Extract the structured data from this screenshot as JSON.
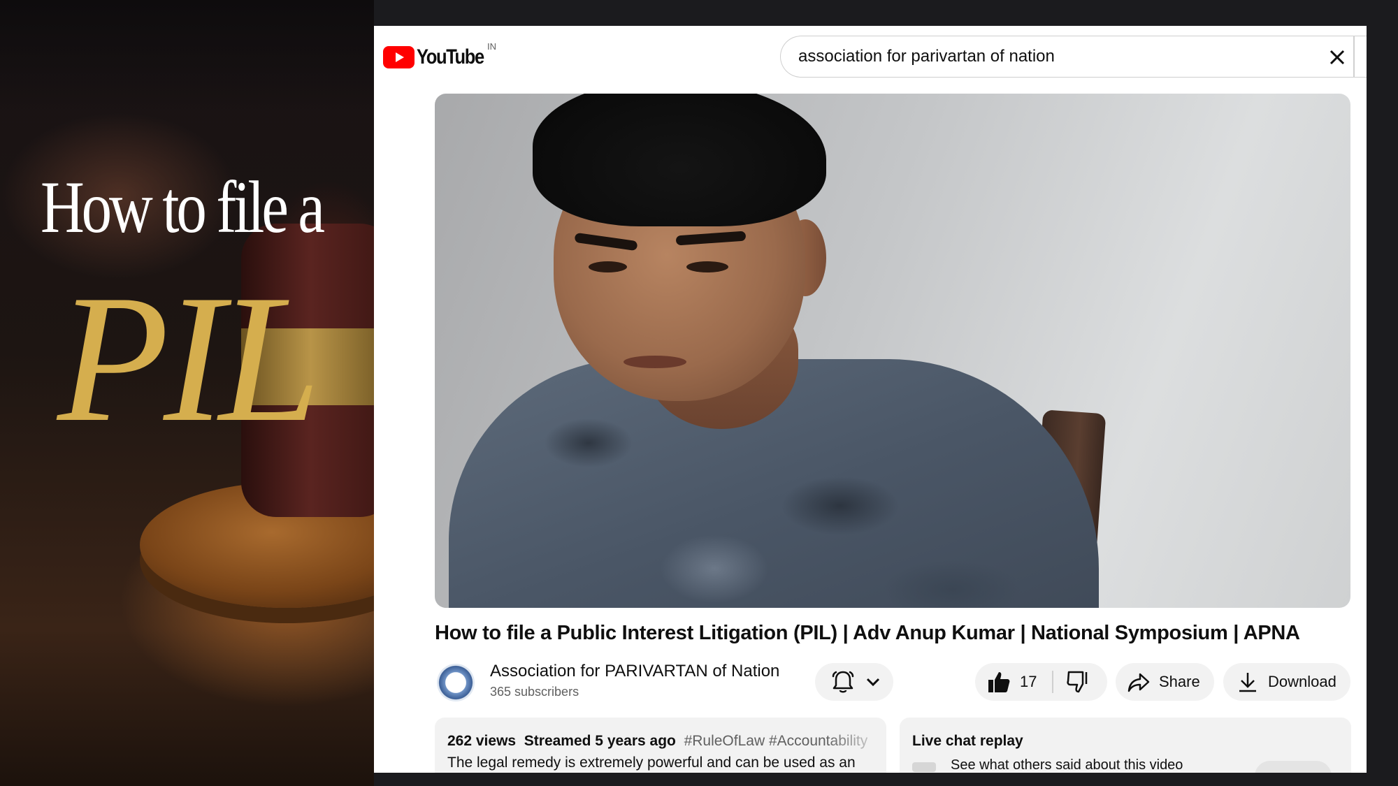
{
  "promo": {
    "line1": "How to file a",
    "line2": "PIL"
  },
  "header": {
    "logo_text": "YouTube",
    "country_code": "IN",
    "search_value": "association for parivartan of nation"
  },
  "video": {
    "title": "How to file a Public Interest Litigation (PIL) | Adv Anup Kumar | National Symposium | APNA"
  },
  "channel": {
    "name": "Association for PARIVARTAN of Nation",
    "subscribers": "365 subscribers"
  },
  "actions": {
    "like_count": "17",
    "share_label": "Share",
    "download_label": "Download"
  },
  "description": {
    "views": "262 views",
    "streamed": "Streamed 5 years ago",
    "hashtags": "#RuleOfLaw #Accountability",
    "text": "The legal remedy is extremely powerful and can be used as an"
  },
  "live_chat": {
    "title": "Live chat replay",
    "subtitle": "See what others said about this video"
  },
  "colors": {
    "brand_red": "#ff0000",
    "promo_gold": "#d5ae4e",
    "pill_bg": "#f2f2f2"
  },
  "icons": [
    "youtube-logo-icon",
    "close-icon",
    "bell-icon",
    "chevron-down-icon",
    "thumbs-up-icon",
    "thumbs-down-icon",
    "share-icon",
    "download-icon",
    "channel-avatar"
  ]
}
